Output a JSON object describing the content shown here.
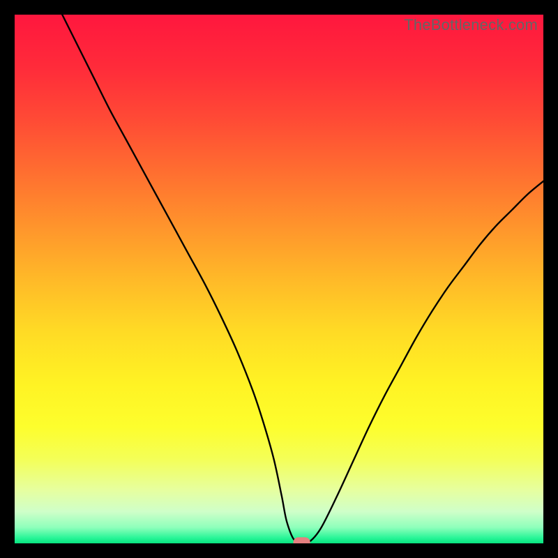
{
  "watermark": "TheBottleneck.com",
  "chart_data": {
    "type": "line",
    "title": "",
    "xlabel": "",
    "ylabel": "",
    "xlim": [
      0,
      100
    ],
    "ylim": [
      0,
      100
    ],
    "grid": false,
    "background_gradient": {
      "stops": [
        {
          "pos": 0.0,
          "color": "#ff173e"
        },
        {
          "pos": 0.1,
          "color": "#ff2b3a"
        },
        {
          "pos": 0.2,
          "color": "#ff4b35"
        },
        {
          "pos": 0.3,
          "color": "#ff6f30"
        },
        {
          "pos": 0.4,
          "color": "#ff942c"
        },
        {
          "pos": 0.5,
          "color": "#ffb928"
        },
        {
          "pos": 0.6,
          "color": "#ffdb25"
        },
        {
          "pos": 0.7,
          "color": "#fff324"
        },
        {
          "pos": 0.78,
          "color": "#fdfe2d"
        },
        {
          "pos": 0.84,
          "color": "#f4ff57"
        },
        {
          "pos": 0.9,
          "color": "#e6ffa0"
        },
        {
          "pos": 0.94,
          "color": "#cfffc9"
        },
        {
          "pos": 0.97,
          "color": "#8effbb"
        },
        {
          "pos": 0.99,
          "color": "#27f597"
        },
        {
          "pos": 1.0,
          "color": "#08e37e"
        }
      ]
    },
    "series": [
      {
        "name": "bottleneck-curve",
        "stroke": "#000000",
        "x": [
          9,
          12,
          15,
          18,
          21,
          24,
          27,
          30,
          33,
          36,
          39,
          42,
          45,
          47,
          49,
          50.5,
          51.5,
          53,
          55,
          56,
          58,
          61,
          64,
          67,
          70,
          73,
          76,
          79,
          82,
          85,
          88,
          91,
          94,
          97,
          100
        ],
        "y": [
          100,
          94,
          88,
          82,
          76.5,
          71,
          65.5,
          60,
          54.5,
          49,
          43,
          36.5,
          29,
          23,
          16,
          9,
          4,
          0.5,
          0.5,
          0.5,
          3,
          9,
          15.5,
          22,
          28,
          33.5,
          39,
          44,
          48.5,
          52.5,
          56.5,
          60,
          63,
          66,
          68.5
        ]
      }
    ],
    "marker": {
      "name": "optimum-marker",
      "x": 54.3,
      "y": 0.2,
      "width": 3.2,
      "height": 1.9,
      "color": "#e58080",
      "rx": 1.0
    }
  }
}
